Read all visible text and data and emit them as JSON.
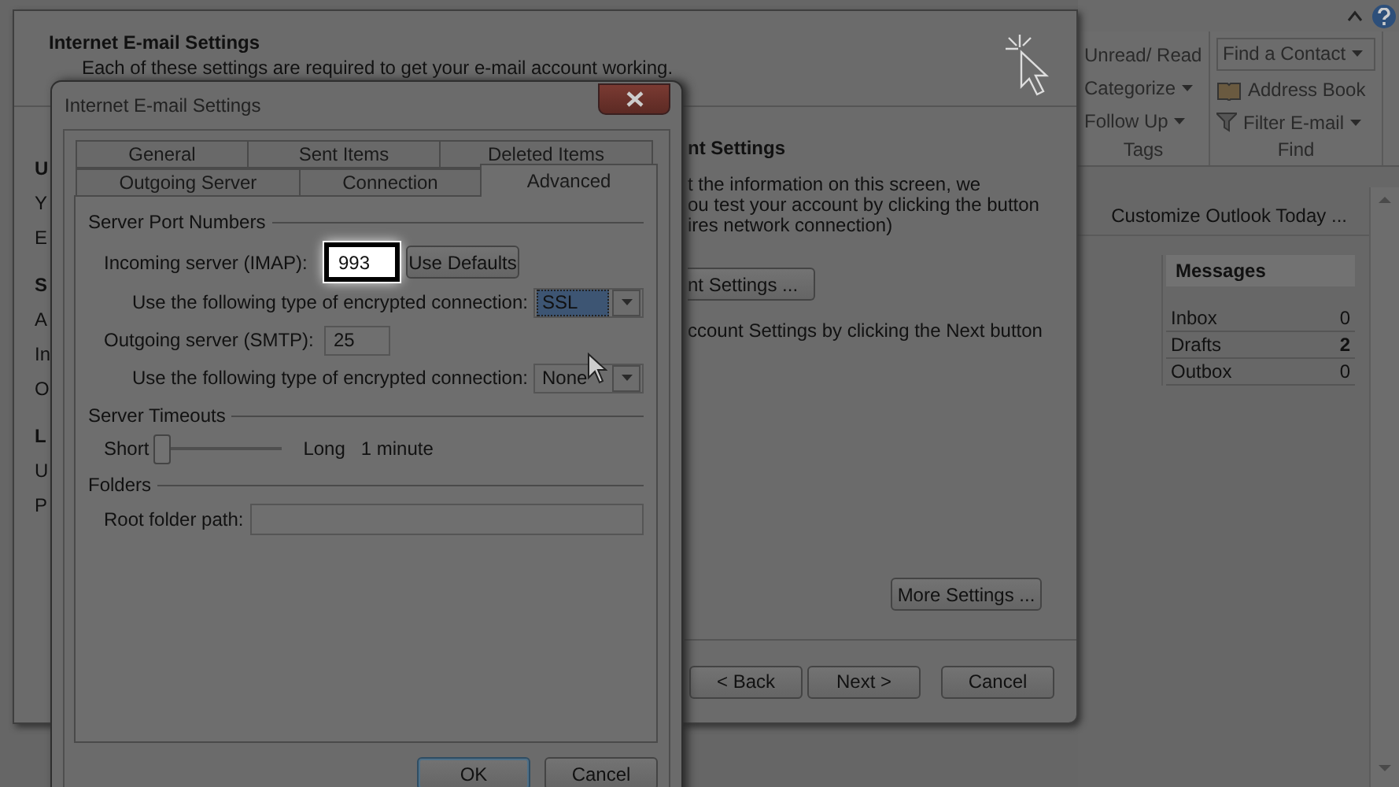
{
  "outlook": {
    "ribbon_groups": [
      {
        "label": "Tags",
        "items": [
          {
            "label": "Unread/ Read",
            "kind": "plain"
          },
          {
            "label": "Categorize",
            "kind": "dropdown"
          },
          {
            "label": "Follow Up",
            "kind": "dropdown"
          }
        ]
      },
      {
        "label": "Find",
        "items": [
          {
            "label": "Find a Contact",
            "kind": "combo"
          },
          {
            "label": "Address Book",
            "kind": "book"
          },
          {
            "label": "Filter E-mail",
            "kind": "filter"
          }
        ]
      }
    ],
    "customize_link": "Customize Outlook Today ...",
    "messages": {
      "title": "Messages",
      "rows": [
        {
          "name": "Inbox",
          "count": "0",
          "bold": false
        },
        {
          "name": "Drafts",
          "count": "2",
          "bold": true
        },
        {
          "name": "Outbox",
          "count": "0",
          "bold": false
        }
      ]
    }
  },
  "back_window": {
    "title": "Internet E-mail Settings",
    "subtitle": "Each of these settings are required to get your e-mail account working.",
    "left_fragments": [
      {
        "text": "U",
        "kind": "heading"
      },
      {
        "text": "Y",
        "kind": "text"
      },
      {
        "text": "E",
        "kind": "text"
      },
      {
        "text": "S",
        "kind": "heading"
      },
      {
        "text": "A",
        "kind": "text"
      },
      {
        "text": "In",
        "kind": "text"
      },
      {
        "text": "O",
        "kind": "text"
      },
      {
        "text": "L",
        "kind": "heading"
      },
      {
        "text": "U",
        "kind": "text"
      },
      {
        "text": "P",
        "kind": "text"
      }
    ],
    "heading": "nt Settings",
    "paragraph_lines": [
      "t the information on this screen, we",
      "ou test your account by clicking the button",
      "ires network connection)"
    ],
    "test_button": "nt Settings ...",
    "note": "ccount Settings by clicking the Next button",
    "more_settings": "More Settings ...",
    "buttons": [
      {
        "label": "< Back"
      },
      {
        "label": "Next >"
      },
      {
        "label": "Cancel"
      }
    ]
  },
  "dialog": {
    "title": "Internet E-mail Settings",
    "tab_rows": [
      [
        {
          "label": "General",
          "selected": false
        },
        {
          "label": "Sent Items",
          "selected": false
        },
        {
          "label": "Deleted Items",
          "selected": false
        }
      ],
      [
        {
          "label": "Outgoing Server",
          "selected": false
        },
        {
          "label": "Connection",
          "selected": false
        },
        {
          "label": "Advanced",
          "selected": true
        }
      ]
    ],
    "port_group": "Server Port Numbers",
    "incoming": {
      "label": "Incoming server (IMAP):",
      "value": "993",
      "spotlight": true,
      "defaults_button": "Use Defaults"
    },
    "incoming_encryption": {
      "label": "Use the following type of encrypted connection:",
      "value": "SSL",
      "highlighted": true
    },
    "outgoing": {
      "label": "Outgoing server (SMTP):",
      "value": "25",
      "spotlight": false
    },
    "outgoing_encryption": {
      "label": "Use the following type of encrypted connection:",
      "value": "None",
      "highlighted": false
    },
    "timeouts_group": "Server Timeouts",
    "timeout": {
      "min_label": "Short",
      "max_label": "Long",
      "level": 0.05,
      "reading": "1 minute"
    },
    "folders_group": "Folders",
    "root_folder": {
      "label": "Root folder path:"
    },
    "buttons": [
      {
        "label": "OK",
        "default": true
      },
      {
        "label": "Cancel",
        "default": false
      }
    ]
  }
}
